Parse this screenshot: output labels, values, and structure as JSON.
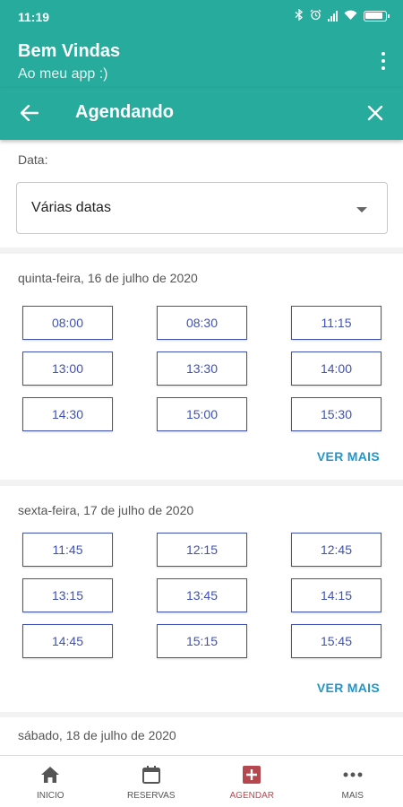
{
  "status_bar": {
    "time": "11:19"
  },
  "header": {
    "title": "Bem Vindas",
    "subtitle": "Ao meu app :)"
  },
  "toolbar": {
    "title": "Agendando"
  },
  "date_filter": {
    "label": "Data:",
    "value": "Várias datas"
  },
  "days": [
    {
      "title": "quinta-feira, 16 de julho de 2020",
      "slots": [
        "08:00",
        "08:30",
        "11:15",
        "13:00",
        "13:30",
        "14:00",
        "14:30",
        "15:00",
        "15:30"
      ],
      "more_label": "VER MAIS"
    },
    {
      "title": "sexta-feira, 17 de julho de 2020",
      "slots": [
        "11:45",
        "12:15",
        "12:45",
        "13:15",
        "13:45",
        "14:15",
        "14:45",
        "15:15",
        "15:45"
      ],
      "more_label": "VER MAIS"
    },
    {
      "title": "sábado, 18 de julho de 2020"
    }
  ],
  "bottom_nav": {
    "items": [
      {
        "label": "INICIO",
        "icon": "home-icon"
      },
      {
        "label": "RESERVAS",
        "icon": "calendar-icon"
      },
      {
        "label": "AGENDAR",
        "icon": "add-box-icon",
        "active": true
      },
      {
        "label": "MAIS",
        "icon": "more-horizontal-icon"
      }
    ]
  },
  "colors": {
    "primary": "#26ab9d",
    "slot_text": "#3f51b5",
    "link": "#2196c9",
    "active_nav": "#b5484f"
  }
}
